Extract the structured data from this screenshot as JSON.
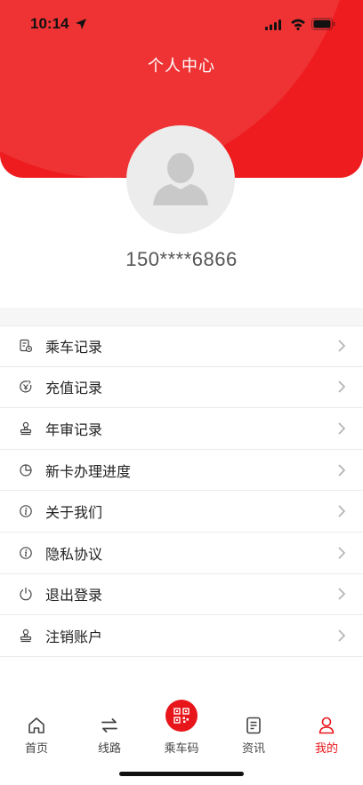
{
  "status_bar": {
    "time": "10:14"
  },
  "header": {
    "title": "个人中心"
  },
  "profile": {
    "phone": "150****6866"
  },
  "menu": {
    "items": [
      {
        "label": "乘车记录",
        "icon": "ride-record-icon"
      },
      {
        "label": "充值记录",
        "icon": "recharge-icon"
      },
      {
        "label": "年审记录",
        "icon": "stamp-icon"
      },
      {
        "label": "新卡办理进度",
        "icon": "progress-icon"
      },
      {
        "label": "关于我们",
        "icon": "info-icon"
      },
      {
        "label": "隐私协议",
        "icon": "info-icon"
      },
      {
        "label": "退出登录",
        "icon": "power-icon"
      },
      {
        "label": "注销账户",
        "icon": "stamp-icon"
      }
    ]
  },
  "tabbar": {
    "tabs": [
      {
        "label": "首页",
        "icon": "home-icon"
      },
      {
        "label": "线路",
        "icon": "route-arrows-icon"
      },
      {
        "label": "乘车码",
        "icon": "qr-code-icon"
      },
      {
        "label": "资讯",
        "icon": "news-icon"
      },
      {
        "label": "我的",
        "icon": "user-icon"
      }
    ],
    "active_index": 4
  },
  "colors": {
    "accent": "#ee1c1f",
    "active_tab": "#e8151b",
    "avatar_bg": "#ececec"
  }
}
